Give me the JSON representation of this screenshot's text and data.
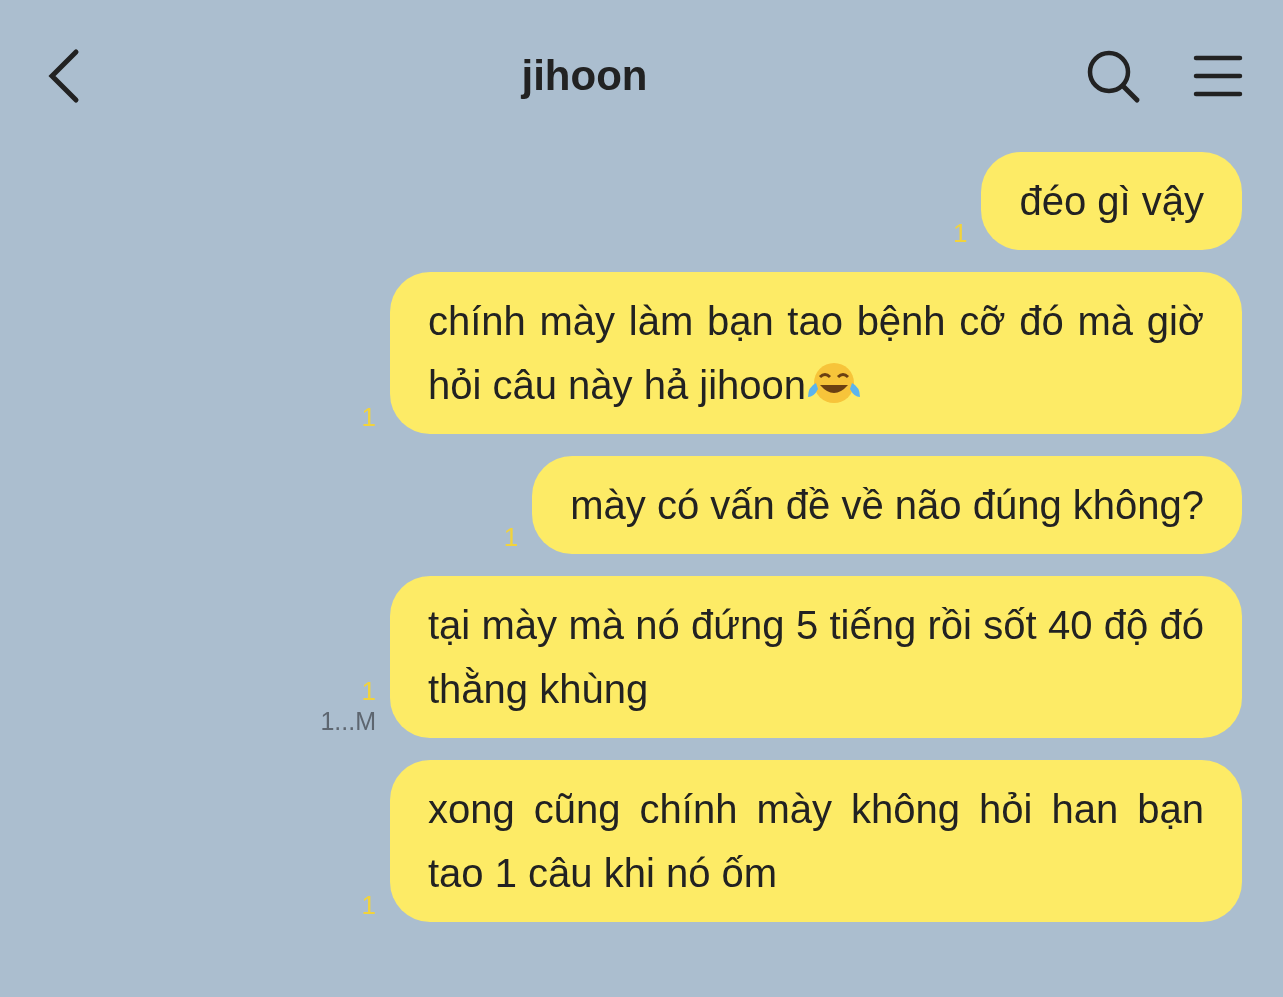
{
  "header": {
    "title": "jihoon"
  },
  "messages": [
    {
      "kind": "text",
      "text": "đéo gì vậy",
      "unread": "1"
    },
    {
      "kind": "text_with_emoji",
      "text": "chính mày làm bạn tao bệnh cỡ đó mà giờ hỏi câu này hả jihoon",
      "unread": "1"
    },
    {
      "kind": "text",
      "text": "mày có vấn đề về não đúng không?",
      "unread": "1"
    },
    {
      "kind": "text",
      "text": "tại mày mà nó đứng 5 tiếng rồi sốt 40 độ đó thằng khùng",
      "unread": "1",
      "time": "1...M"
    },
    {
      "kind": "text",
      "text": "xong cũng chính mày không hỏi han bạn tao 1 câu khi nó ốm",
      "unread": "1"
    }
  ]
}
